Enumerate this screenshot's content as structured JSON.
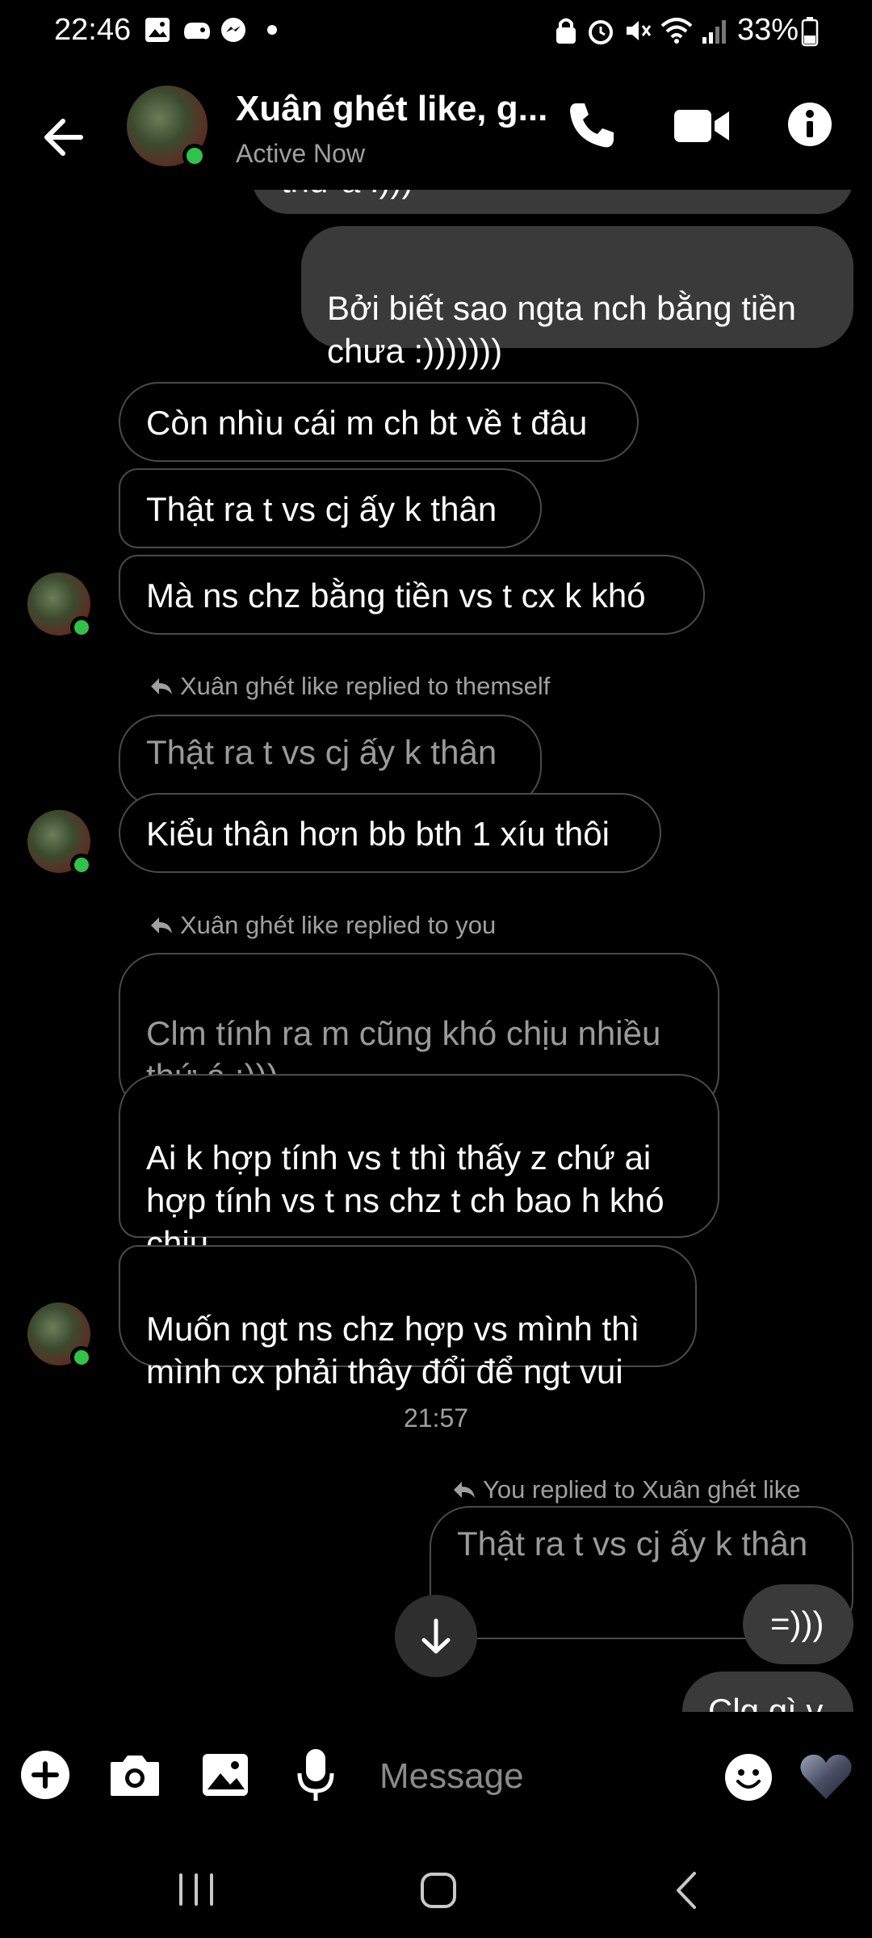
{
  "status_bar": {
    "time": "22:46",
    "battery": "33%"
  },
  "header": {
    "contact_name": "Xuân ghét like, g...",
    "status": "Active Now"
  },
  "messages": {
    "m0": "thứ á :)))",
    "m1": "Bởi biết sao ngta nch bằng tiền\nchưa :)))))))",
    "m2": "Còn nhìu cái m ch bt về t đâu",
    "m3": "Thật ra t vs cj ấy k thân",
    "m4": "Mà ns chz bằng tiền vs t cx k khó",
    "reply1": "Xuân ghét like replied to themself",
    "q1": "Thật ra t vs cj ấy k thân",
    "m5": "Kiểu thân hơn bb bth 1 xíu thôi",
    "reply2": "Xuân ghét like replied to you",
    "q2": "Clm tính ra m cũng khó chịu nhiều\nthứ á :)))",
    "m6": "Ai k hợp tính vs t thì thấy z chứ ai\nhợp tính vs t ns chz t ch bao h khó\nchịu",
    "m7": "Muốn ngt ns chz hợp vs mình thì\nmình cx phải thây đổi để ngt vui",
    "time": "21:57",
    "reply3": "You replied to Xuân ghét like",
    "q3": "Thật ra t vs cj ấy k thân",
    "m8": "=)))",
    "m9": "Clg gì v"
  },
  "composer": {
    "placeholder": "Message"
  },
  "colors": {
    "online": "#31c24a",
    "incoming_border": "#4a4a4a",
    "outgoing_bg": "#3a3a3a",
    "muted_text": "#a0a0a0"
  },
  "icons": [
    "back-arrow-icon",
    "phone-icon",
    "video-camera-icon",
    "info-icon",
    "reply-arrow-icon",
    "chevron-down-icon",
    "plus-icon",
    "camera-icon",
    "image-icon",
    "microphone-icon",
    "emoji-icon",
    "heart-icon"
  ]
}
